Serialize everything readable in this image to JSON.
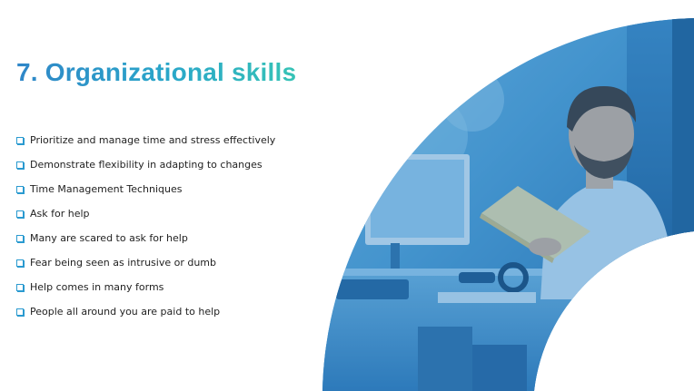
{
  "slide": {
    "title": "7. Organizational skills",
    "bullets": [
      "Prioritize and manage time and stress effectively",
      "Demonstrate flexibility in adapting to changes",
      "Time Management Techniques",
      "Ask for help",
      "Many are scared to ask for help",
      "Fear being seen as intrusive or dumb",
      "Help comes in many forms",
      "People all around you are paid to help"
    ],
    "bullet_icon": "checkbox-square-icon"
  },
  "colors": {
    "title_gradient_start": "#2f86c8",
    "title_gradient_end": "#36c3b6",
    "photo_tint": "#2f7fc4",
    "bullet_icon": "#2a9ad0",
    "body_text": "#222222"
  }
}
